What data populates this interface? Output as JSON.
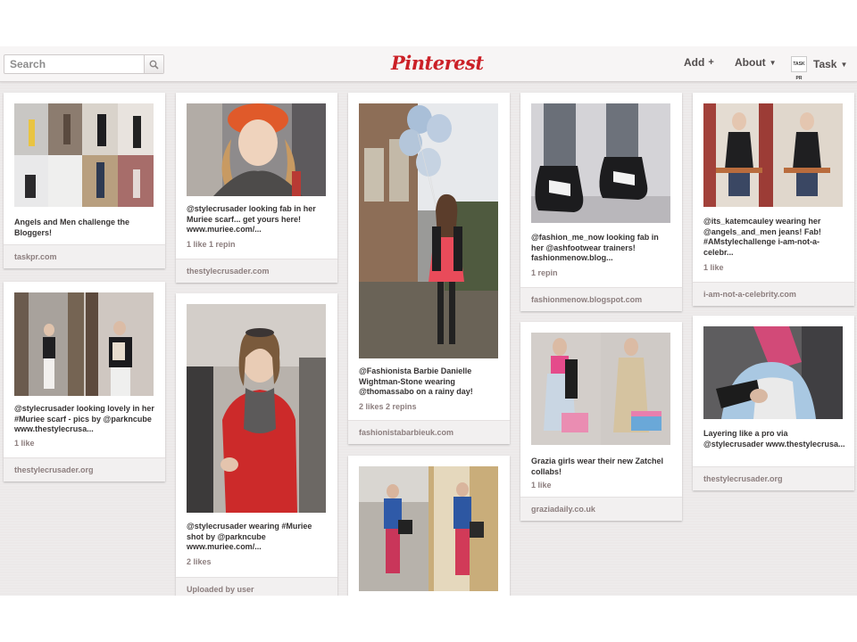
{
  "header": {
    "search_placeholder": "Search",
    "logo": "Pinterest",
    "add_label": "Add",
    "add_symbol": "+",
    "about_label": "About",
    "user_label": "Task",
    "avatar_text": "TASK PR"
  },
  "colors": {
    "brand": "#cb2027",
    "board_bg": "#ece9e9",
    "footer_bg": "#f2f0f0"
  },
  "pins": [
    {
      "desc": "Angels and Men challenge the Bloggers!",
      "stats": "",
      "source": "taskpr.com"
    },
    {
      "desc": "@stylecrusader looking lovely in her #Muriee scarf - pics by @parkncube www.thestylecrusa...",
      "stats": "1 like",
      "source": "thestylecrusader.org"
    },
    {
      "desc": "@stylecrusader looking fab in her Muriee scarf... get yours here! www.muriee.com/...",
      "stats": "1 like   1 repin",
      "source": "thestylecrusader.com"
    },
    {
      "desc": "@stylecrusader wearing #Muriee shot by @parkncube www.muriee.com/...",
      "stats": "2 likes",
      "source": "Uploaded by user"
    },
    {
      "desc": "@Fashionista Barbie Danielle Wightman-Stone wearing @thomassabo on a rainy day!",
      "stats": "2 likes   2 repins",
      "source": "fashionistabarbieuk.com"
    },
    {
      "desc": "",
      "stats": "",
      "source": ""
    },
    {
      "desc": "@fashion_me_now looking fab in her @ashfootwear trainers! fashionmenow.blog...",
      "stats": "1 repin",
      "source": "fashionmenow.blogspot.com"
    },
    {
      "desc": "Grazia girls wear their new Zatchel collabs!",
      "stats": "1 like",
      "source": "graziadaily.co.uk"
    },
    {
      "desc": "@its_katemcauley wearing her @angels_and_men jeans! Fab! #AMstylechallenge i-am-not-a-celebr...",
      "stats": "1 like",
      "source": "i-am-not-a-celebrity.com"
    },
    {
      "desc": "Layering like a pro via @stylecrusader www.thestylecrusa...",
      "stats": "",
      "source": "thestylecrusader.org"
    }
  ]
}
